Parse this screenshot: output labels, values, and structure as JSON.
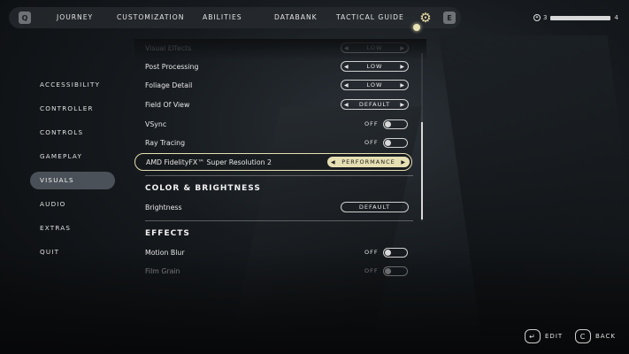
{
  "nav": {
    "left_key": "Q",
    "right_key": "E",
    "tabs": [
      "JOURNEY",
      "CUSTOMIZATION",
      "ABILITIES",
      "DATABANK",
      "TACTICAL GUIDE"
    ],
    "active_icon": "gear-icon"
  },
  "status": {
    "level": "3",
    "next_level": "4",
    "progress": 0.9
  },
  "menu": {
    "items": [
      "ACCESSIBILITY",
      "CONTROLLER",
      "CONTROLS",
      "GAMEPLAY",
      "VISUALS",
      "AUDIO",
      "EXTRAS",
      "QUIT"
    ],
    "active": "VISUALS"
  },
  "settings": {
    "partial_row": {
      "label": "Visual Effects",
      "value": "LOW"
    },
    "post_processing": {
      "label": "Post Processing",
      "value": "LOW"
    },
    "foliage_detail": {
      "label": "Foliage Detail",
      "value": "LOW"
    },
    "field_of_view": {
      "label": "Field Of View",
      "value": "DEFAULT"
    },
    "vsync": {
      "label": "VSync",
      "value": "OFF"
    },
    "ray_tracing": {
      "label": "Ray Tracing",
      "value": "OFF"
    },
    "fsr": {
      "label": "AMD FidelityFX™ Super Resolution 2",
      "value": "PERFORMANCE"
    },
    "color_section": "COLOR & BRIGHTNESS",
    "brightness": {
      "label": "Brightness",
      "value": "DEFAULT"
    },
    "effects_section": "EFFECTS",
    "motion_blur": {
      "label": "Motion Blur",
      "value": "OFF"
    },
    "film_grain": {
      "label": "Film Grain",
      "value": "OFF"
    }
  },
  "hints": {
    "edit": "EDIT",
    "back_key": "C",
    "back": "BACK"
  }
}
